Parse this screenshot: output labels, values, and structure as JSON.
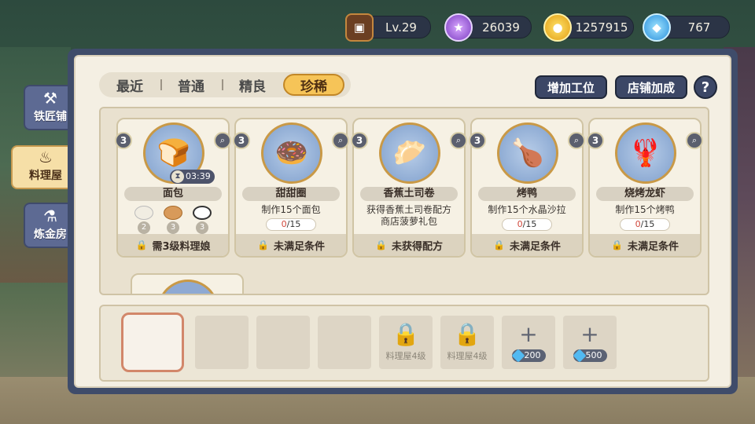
{
  "resources": {
    "level": "Lv.29",
    "star": "26039",
    "gold": "1257915",
    "gem": "767"
  },
  "side_tabs": [
    {
      "label": "铁匠铺",
      "icon": "anvil-icon"
    },
    {
      "label": "料理屋",
      "icon": "pot-icon"
    },
    {
      "label": "炼金房",
      "icon": "flask-icon"
    }
  ],
  "filter_tabs": [
    "最近",
    "普通",
    "精良",
    "珍稀"
  ],
  "buttons": {
    "add_slot": "增加工位",
    "shop_bonus": "店铺加成",
    "help": "?"
  },
  "recipes": [
    {
      "level": "3",
      "name": "面包",
      "timer": "03:39",
      "ingredients": [
        "2",
        "3",
        "3"
      ],
      "footer": "需3级料理娘"
    },
    {
      "level": "3",
      "name": "甜甜圈",
      "desc": "制作15个面包",
      "progress_done": "0",
      "progress_total": "/15",
      "footer": "未满足条件"
    },
    {
      "level": "3",
      "name": "香蕉土司卷",
      "desc_line1": "获得香蕉土司卷配方",
      "desc_line2": "商店菠萝礼包",
      "footer": "未获得配方"
    },
    {
      "level": "3",
      "name": "烤鸭",
      "desc": "制作15个水晶沙拉",
      "progress_done": "0",
      "progress_total": "/15",
      "footer": "未满足条件"
    },
    {
      "level": "3",
      "name": "烧烤龙虾",
      "desc": "制作15个烤鸭",
      "progress_done": "0",
      "progress_total": "/15",
      "footer": "未满足条件"
    }
  ],
  "slots": {
    "locked_label": "料理屋4级",
    "price_1": "200",
    "price_2": "500"
  }
}
